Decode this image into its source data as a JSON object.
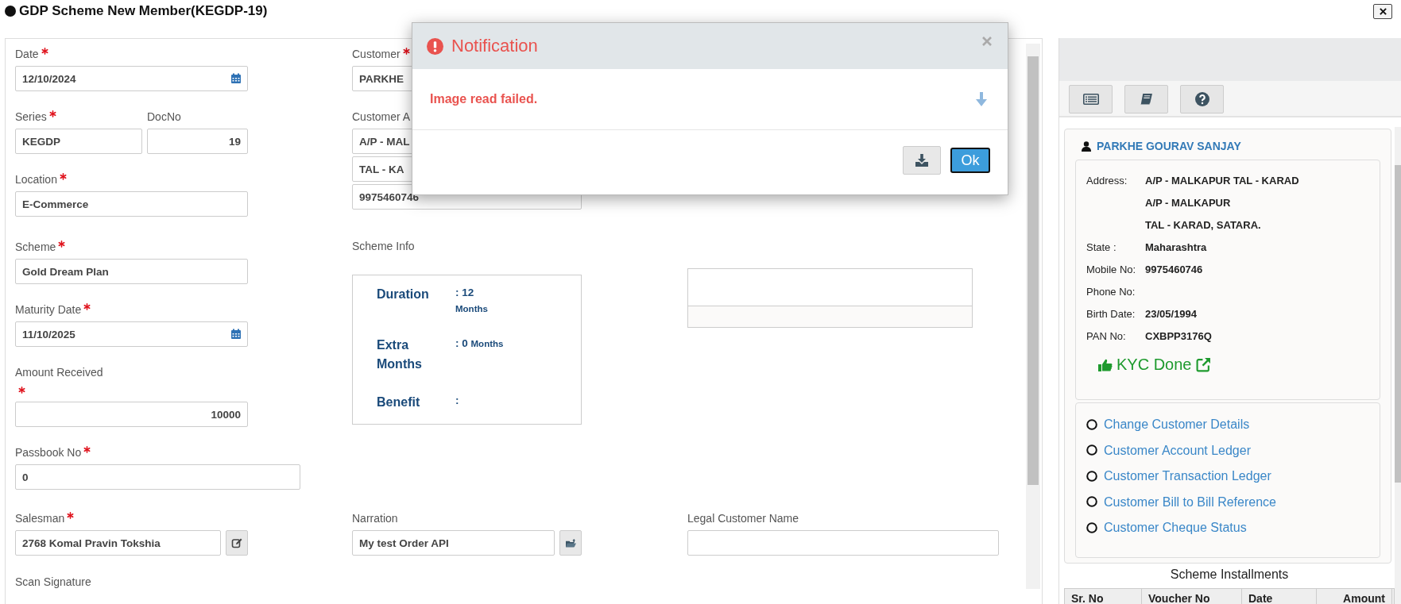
{
  "window": {
    "title": "GDP Scheme New Member(KEGDP-19)"
  },
  "form": {
    "date": {
      "label": "Date",
      "required": true,
      "value": "12/10/2024"
    },
    "series": {
      "label": "Series",
      "required": true,
      "value": "KEGDP"
    },
    "doc_no": {
      "label": "DocNo",
      "value": "19"
    },
    "location": {
      "label": "Location",
      "required": true,
      "value": "E-Commerce"
    },
    "scheme": {
      "label": "Scheme",
      "required": true,
      "value": "Gold Dream Plan"
    },
    "maturity_date": {
      "label": "Maturity Date",
      "required": true,
      "value": "11/10/2025"
    },
    "amount_received": {
      "label": "Amount Received",
      "required": true,
      "value": "10000"
    },
    "passbook_no": {
      "label": "Passbook No",
      "required": true,
      "value": "0"
    },
    "customer": {
      "label": "Customer",
      "required": true,
      "value": "PARKHE"
    },
    "customer_address": {
      "label": "Customer A",
      "lines": [
        "A/P - MAL",
        "TAL - KA"
      ],
      "mobile": "9975460746"
    },
    "scheme_info": {
      "label": "Scheme Info",
      "rows": [
        {
          "label": "Duration",
          "value": ": 12",
          "unit": "Months"
        },
        {
          "label": "Extra Months",
          "value": ": 0",
          "unit": "Months"
        },
        {
          "label": "Benefit",
          "value": ":"
        }
      ]
    },
    "salesman": {
      "label": "Salesman",
      "required": true,
      "value": "2768 Komal Pravin Tokshia"
    },
    "narration": {
      "label": "Narration",
      "value": "My test Order API"
    },
    "legal_customer_name": {
      "label": "Legal Customer Name"
    },
    "scan_signature": {
      "label": "Scan Signature"
    }
  },
  "customer_panel": {
    "name": "PARKHE GOURAV SANJAY",
    "details": [
      {
        "label": "Address:",
        "lines": [
          "A/P - MALKAPUR TAL - KARAD",
          "A/P - MALKAPUR",
          "TAL - KARAD, SATARA."
        ]
      },
      {
        "label": "State :",
        "lines": [
          "Maharashtra"
        ]
      },
      {
        "label": "Mobile No:",
        "lines": [
          "9975460746"
        ]
      },
      {
        "label": "Phone No:"
      },
      {
        "label": "Birth Date:",
        "lines": [
          "23/05/1994"
        ]
      },
      {
        "label": "PAN No:",
        "lines": [
          "CXBPP3176Q"
        ]
      }
    ],
    "kyc": "KYC Done",
    "links": [
      "Change Customer Details",
      "Customer Account Ledger",
      "Customer Transaction Ledger",
      "Customer Bill to Bill Reference",
      "Customer Cheque Status"
    ]
  },
  "installments": {
    "title": "Scheme Installments",
    "columns": [
      "Sr. No",
      "Voucher No",
      "Date",
      "Amount"
    ]
  },
  "notification": {
    "title": "Notification",
    "message": "Image read failed.",
    "ok_label": "Ok"
  }
}
